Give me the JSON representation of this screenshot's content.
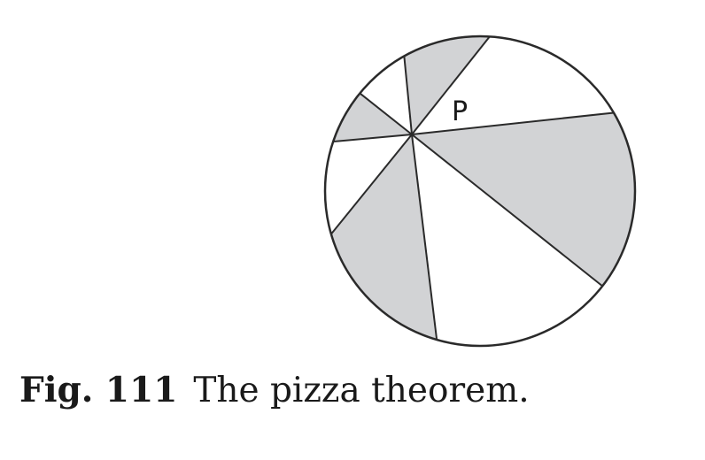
{
  "diagram": {
    "point_label": "P",
    "shaded_color": "#d2d3d5",
    "unshaded_color": "#ffffff",
    "line_color": "#2a2a2a"
  },
  "caption": {
    "figure_number": "Fig. 111",
    "text": "The pizza theorem."
  }
}
